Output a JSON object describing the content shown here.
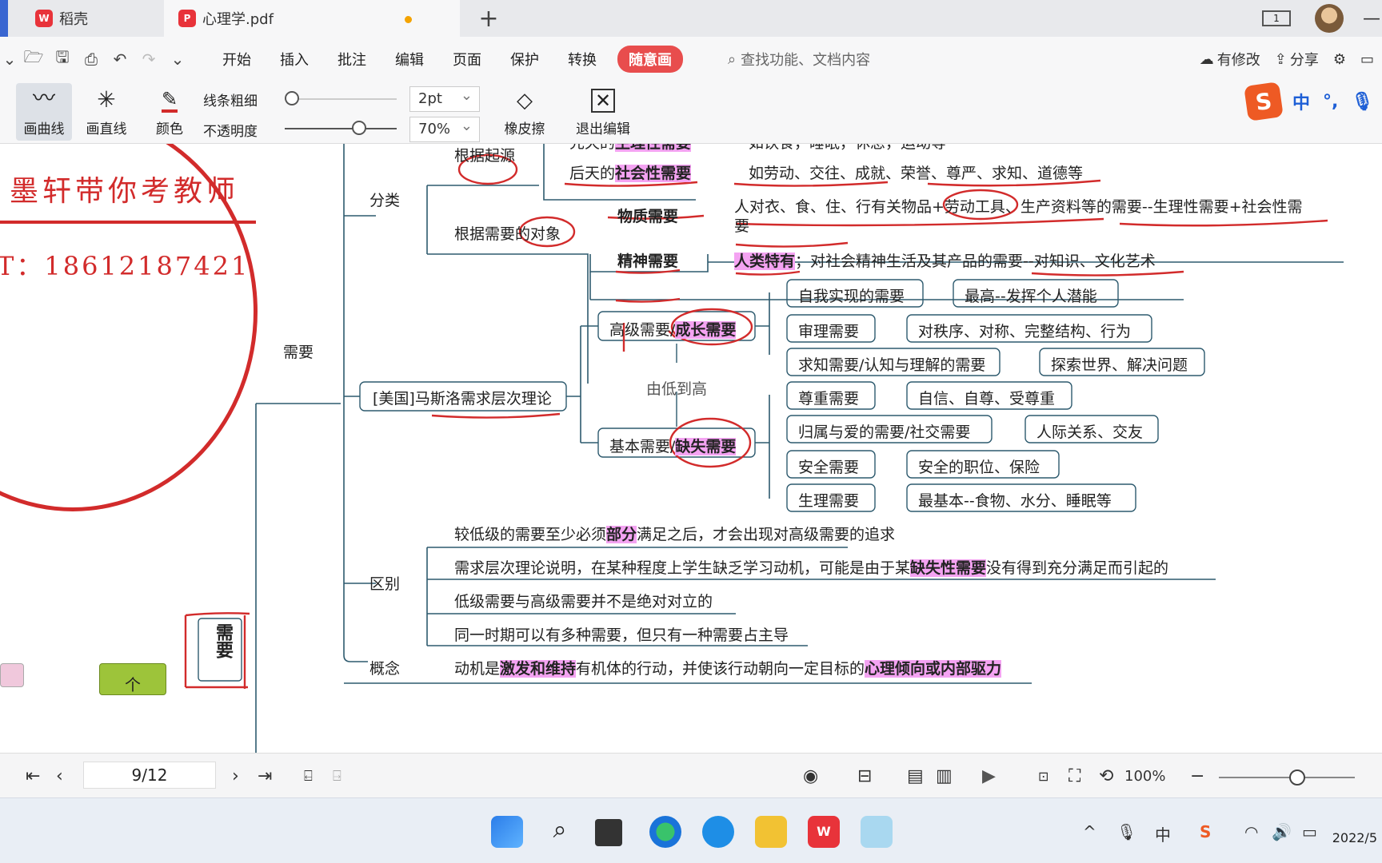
{
  "tabs": [
    {
      "label": "稻壳"
    },
    {
      "label": "心理学.pdf"
    }
  ],
  "window": {
    "page_indicator": "1"
  },
  "menu": {
    "items": [
      "开始",
      "插入",
      "批注",
      "编辑",
      "页面",
      "保护",
      "转换"
    ],
    "special": "随意画",
    "search_placeholder": "查找功能、文档内容",
    "modified": "有修改",
    "share": "分享"
  },
  "toolbar": {
    "draw_curve": "画曲线",
    "draw_line": "画直线",
    "color": "颜色",
    "line_width_label": "线条粗细",
    "line_width_value": "2pt",
    "opacity_label": "不透明度",
    "opacity_value": "70%",
    "eraser": "橡皮擦",
    "exit": "退出编辑",
    "accent_color": "#d22b2b"
  },
  "ime": {
    "mode": "中"
  },
  "stamp": {
    "line1": "墨轩带你考教师",
    "line2": "T：18612187421"
  },
  "mindmap": {
    "root": "需要",
    "classify": {
      "label": "分类",
      "by_origin": "根据起源",
      "innate_prefix": "先天的",
      "innate_hl": "生理性需要",
      "innate_desc": "如饮食，睡眠，休息，运动等",
      "acquired_prefix": "后天的",
      "acquired_hl": "社会性需要",
      "acquired_desc": "如劳动、交往、成就、荣誉、尊严、求知、道德等",
      "by_object": "根据需要的对象",
      "material": "物质需要",
      "material_desc_1": "人对衣、食、住、行有关物品+劳动工具、生产资料等的需要--生理性需要+社会性需",
      "material_desc_2": "要",
      "spiritual": "精神需要",
      "spiritual_hl": "人类特有",
      "spiritual_desc": "；对社会精神生活及其产品的需要--对知识、文化艺术"
    },
    "maslow": {
      "label": "[美国]马斯洛需求层次理论",
      "high_prefix": "高级需要/",
      "high_hl": "成长需要",
      "low_prefix": "基本需要/",
      "low_hl": "缺失需要",
      "direction": "由低到高",
      "high_items": [
        {
          "name": "自我实现的需要",
          "desc": "最高--发挥个人潜能"
        },
        {
          "name": "审理需要",
          "desc": "对秩序、对称、完整结构、行为"
        },
        {
          "name": "求知需要/认知与理解的需要",
          "desc": "探索世界、解决问题"
        }
      ],
      "low_items": [
        {
          "name": "尊重需要",
          "desc": "自信、自尊、受尊重"
        },
        {
          "name": "归属与爱的需要/社交需要",
          "desc": "人际关系、交友"
        },
        {
          "name": "安全需要",
          "desc": "安全的职位、保险"
        },
        {
          "name": "生理需要",
          "desc": "最基本--食物、水分、睡眠等"
        }
      ]
    },
    "difference": {
      "label": "区别",
      "line1_a": "较低级的需要至少必须",
      "line1_hl": "部分",
      "line1_b": "满足之后，才会出现对高级需要的追求",
      "line2_a": "需求层次理论说明，在某种程度上学生缺乏学习动机，可能是由于某",
      "line2_hl": "缺失性需要",
      "line2_b": "没有得到充分满足而引起的",
      "line3": "低级需要与高级需要并不是绝对对立的",
      "line4": "同一时期可以有多种需要，但只有一种需要占主导"
    },
    "concept": {
      "label": "概念",
      "a": "动机是",
      "hl1": "激发和维持",
      "b": "有机体的行动，并使该行动朝向一定目标的",
      "hl2": "心理倾向或内部驱力"
    },
    "side_node": "需要",
    "left_node": "个"
  },
  "status": {
    "page": "9/12",
    "zoom": "100%"
  },
  "taskbar": {
    "clock": "2022/5",
    "tray_lang": "中"
  }
}
